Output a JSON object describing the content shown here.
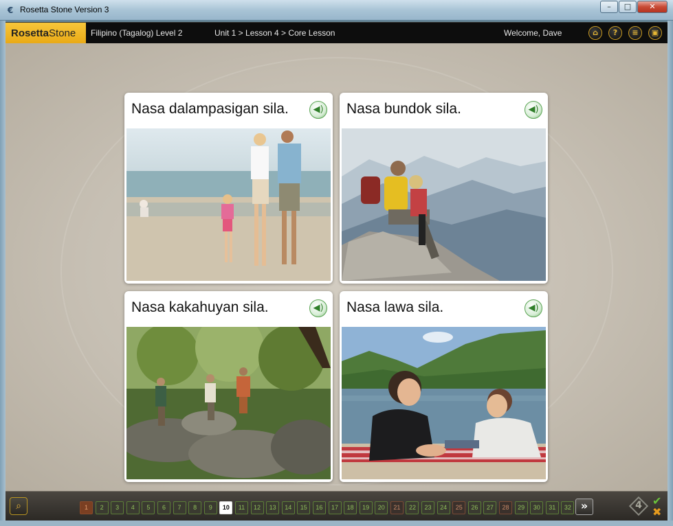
{
  "window": {
    "title": "Rosetta Stone Version 3",
    "controls": {
      "minimize": "–",
      "maximize": "□",
      "close": "✕"
    }
  },
  "header": {
    "logo_bold": "Rosetta",
    "logo_thin": "Stone",
    "course": "Filipino (Tagalog) Level 2",
    "breadcrumb": "Unit 1 > Lesson 4 > Core Lesson",
    "welcome": "Welcome, Dave",
    "icons": [
      "home-icon",
      "help-icon",
      "menu-icon",
      "window-icon"
    ]
  },
  "cards": [
    {
      "caption": "Nasa dalampasigan sila.",
      "scene": "beach"
    },
    {
      "caption": "Nasa bundok sila.",
      "scene": "mountain"
    },
    {
      "caption": "Nasa kakahuyan sila.",
      "scene": "forest"
    },
    {
      "caption": "Nasa lawa sila.",
      "scene": "lake"
    }
  ],
  "footer": {
    "screens": [
      {
        "n": "1",
        "state": "done"
      },
      {
        "n": "2",
        "state": "todo"
      },
      {
        "n": "3",
        "state": "todo"
      },
      {
        "n": "4",
        "state": "todo"
      },
      {
        "n": "5",
        "state": "todo"
      },
      {
        "n": "6",
        "state": "todo"
      },
      {
        "n": "7",
        "state": "todo"
      },
      {
        "n": "8",
        "state": "todo"
      },
      {
        "n": "9",
        "state": "todo"
      },
      {
        "n": "10",
        "state": "current"
      },
      {
        "n": "11",
        "state": "todo"
      },
      {
        "n": "12",
        "state": "todo"
      },
      {
        "n": "13",
        "state": "todo"
      },
      {
        "n": "14",
        "state": "todo"
      },
      {
        "n": "15",
        "state": "todo"
      },
      {
        "n": "16",
        "state": "todo"
      },
      {
        "n": "17",
        "state": "todo"
      },
      {
        "n": "18",
        "state": "todo"
      },
      {
        "n": "19",
        "state": "todo"
      },
      {
        "n": "20",
        "state": "todo"
      },
      {
        "n": "21",
        "state": "partial"
      },
      {
        "n": "22",
        "state": "todo"
      },
      {
        "n": "23",
        "state": "todo"
      },
      {
        "n": "24",
        "state": "todo"
      },
      {
        "n": "25",
        "state": "partial"
      },
      {
        "n": "26",
        "state": "todo"
      },
      {
        "n": "27",
        "state": "todo"
      },
      {
        "n": "28",
        "state": "partial"
      },
      {
        "n": "29",
        "state": "todo"
      },
      {
        "n": "30",
        "state": "todo"
      },
      {
        "n": "31",
        "state": "todo"
      },
      {
        "n": "32",
        "state": "todo"
      }
    ],
    "next_label": "»",
    "counter": "4"
  }
}
